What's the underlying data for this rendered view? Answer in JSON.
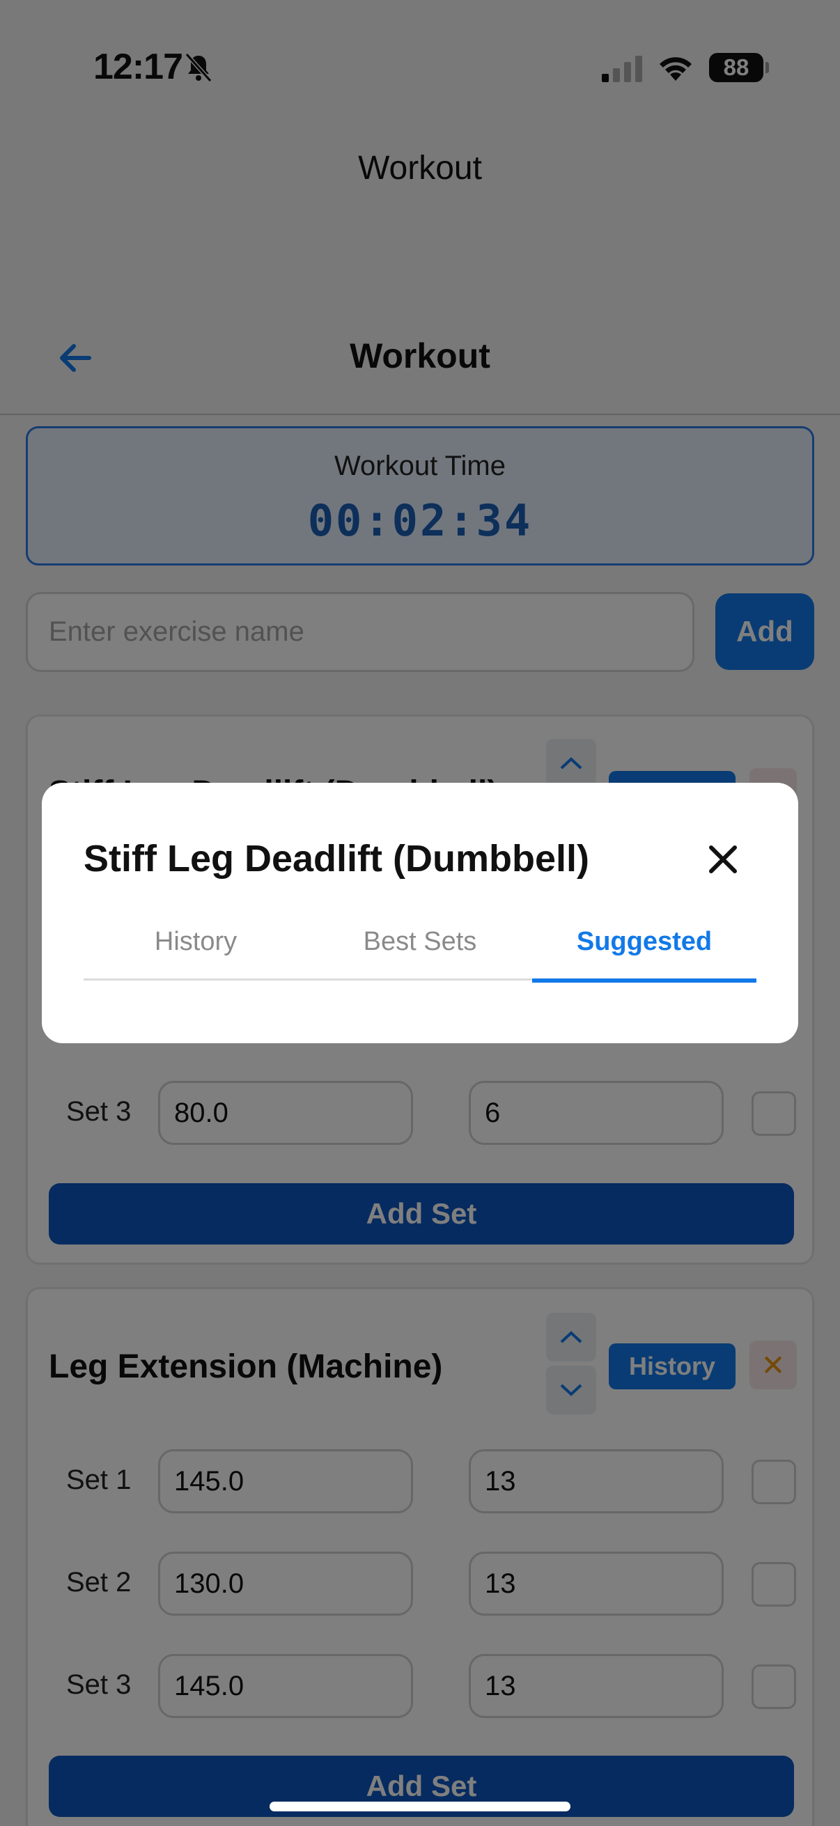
{
  "status_bar": {
    "time": "12:17",
    "battery": "88"
  },
  "top_title": "Workout",
  "header": {
    "title": "Workout"
  },
  "timer": {
    "label": "Workout Time",
    "value": "00:02:34"
  },
  "exercise_entry": {
    "placeholder": "Enter exercise name",
    "add_label": "Add"
  },
  "exercises": [
    {
      "name": "Stiff Leg Deadlift (Dumbbell)",
      "history_label": "History",
      "sets": [
        {
          "label": "Set 3",
          "weight": "80.0",
          "reps": "6"
        }
      ],
      "add_set_label": "Add Set"
    },
    {
      "name": "Leg Extension (Machine)",
      "history_label": "History",
      "sets": [
        {
          "label": "Set 1",
          "weight": "145.0",
          "reps": "13"
        },
        {
          "label": "Set 2",
          "weight": "130.0",
          "reps": "13"
        },
        {
          "label": "Set 3",
          "weight": "145.0",
          "reps": "13"
        }
      ],
      "add_set_label": "Add Set"
    }
  ],
  "modal": {
    "title": "Stiff Leg Deadlift (Dumbbell)",
    "tabs": [
      "History",
      "Best Sets",
      "Suggested"
    ],
    "active_tab": "Suggested"
  },
  "colors": {
    "accent": "#1279e8",
    "primary_dark": "#0c56c0",
    "delete": "#e8920f"
  }
}
